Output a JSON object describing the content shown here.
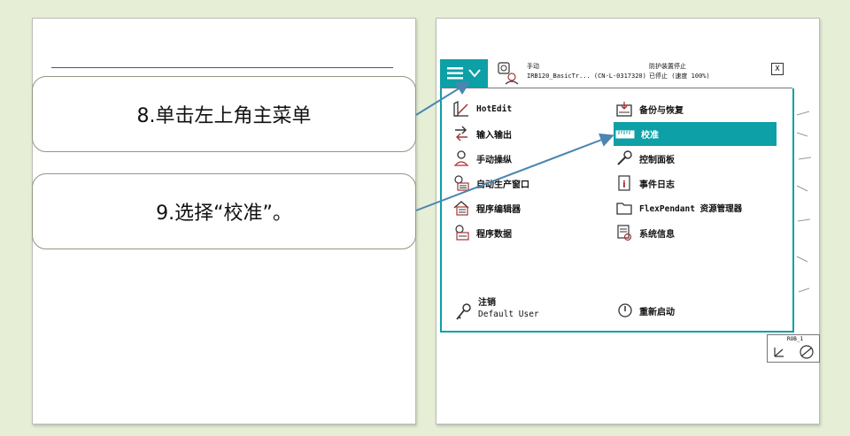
{
  "instructions": {
    "step8": "8.单击左上角主菜单",
    "step9": "9.选择“校准”。"
  },
  "header": {
    "mode": "手动",
    "system": "IRB120_BasicTr... (CN-L-0317320)",
    "state": "防护装置停止",
    "speed": "已停止 (速度 100%)",
    "close": "X"
  },
  "menu": {
    "left": [
      {
        "label": "HotEdit",
        "icon": "hotedit-icon"
      },
      {
        "label": "输入输出",
        "icon": "io-icon"
      },
      {
        "label": "手动操纵",
        "icon": "jog-icon"
      },
      {
        "label": "自动生产窗口",
        "icon": "production-window-icon"
      },
      {
        "label": "程序编辑器",
        "icon": "program-editor-icon"
      },
      {
        "label": "程序数据",
        "icon": "program-data-icon"
      }
    ],
    "right": [
      {
        "label": "备份与恢复",
        "icon": "backup-icon"
      },
      {
        "label": "校准",
        "icon": "calibration-icon"
      },
      {
        "label": "控制面板",
        "icon": "wrench-icon"
      },
      {
        "label": "事件日志",
        "icon": "event-log-icon"
      },
      {
        "label": "FlexPendant 资源管理器",
        "icon": "folder-icon"
      },
      {
        "label": "系统信息",
        "icon": "system-info-icon"
      }
    ],
    "logout": "注销",
    "user": "Default User",
    "restart": "重新启动"
  },
  "corner": {
    "label": "ROB_1"
  },
  "colors": {
    "accent": "#0da0a6",
    "arrow": "#4a86b0",
    "background": "#e6eed6"
  }
}
